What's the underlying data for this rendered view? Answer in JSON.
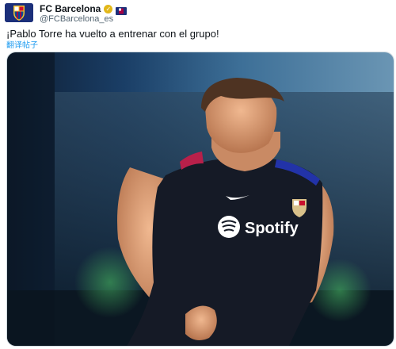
{
  "tweet": {
    "author_name": "FC Barcelona",
    "author_handle": "@FCBarcelona_es",
    "text": "¡Pablo Torre ha vuelto a entrenar con el grupo!",
    "translate_label": "翻译帖子"
  },
  "shirt": {
    "sponsor_text": "Spotify"
  },
  "icons": {
    "avatar": "fcb-crest-icon",
    "verified": "gold-verified-badge-icon",
    "affiliate": "fcb-affiliate-badge-icon"
  },
  "colors": {
    "link": "#1d9bf0",
    "secondary_text": "#536471",
    "verified_gold": "#e2b719",
    "club_blue": "#1b2f7a",
    "club_red": "#a50044"
  }
}
